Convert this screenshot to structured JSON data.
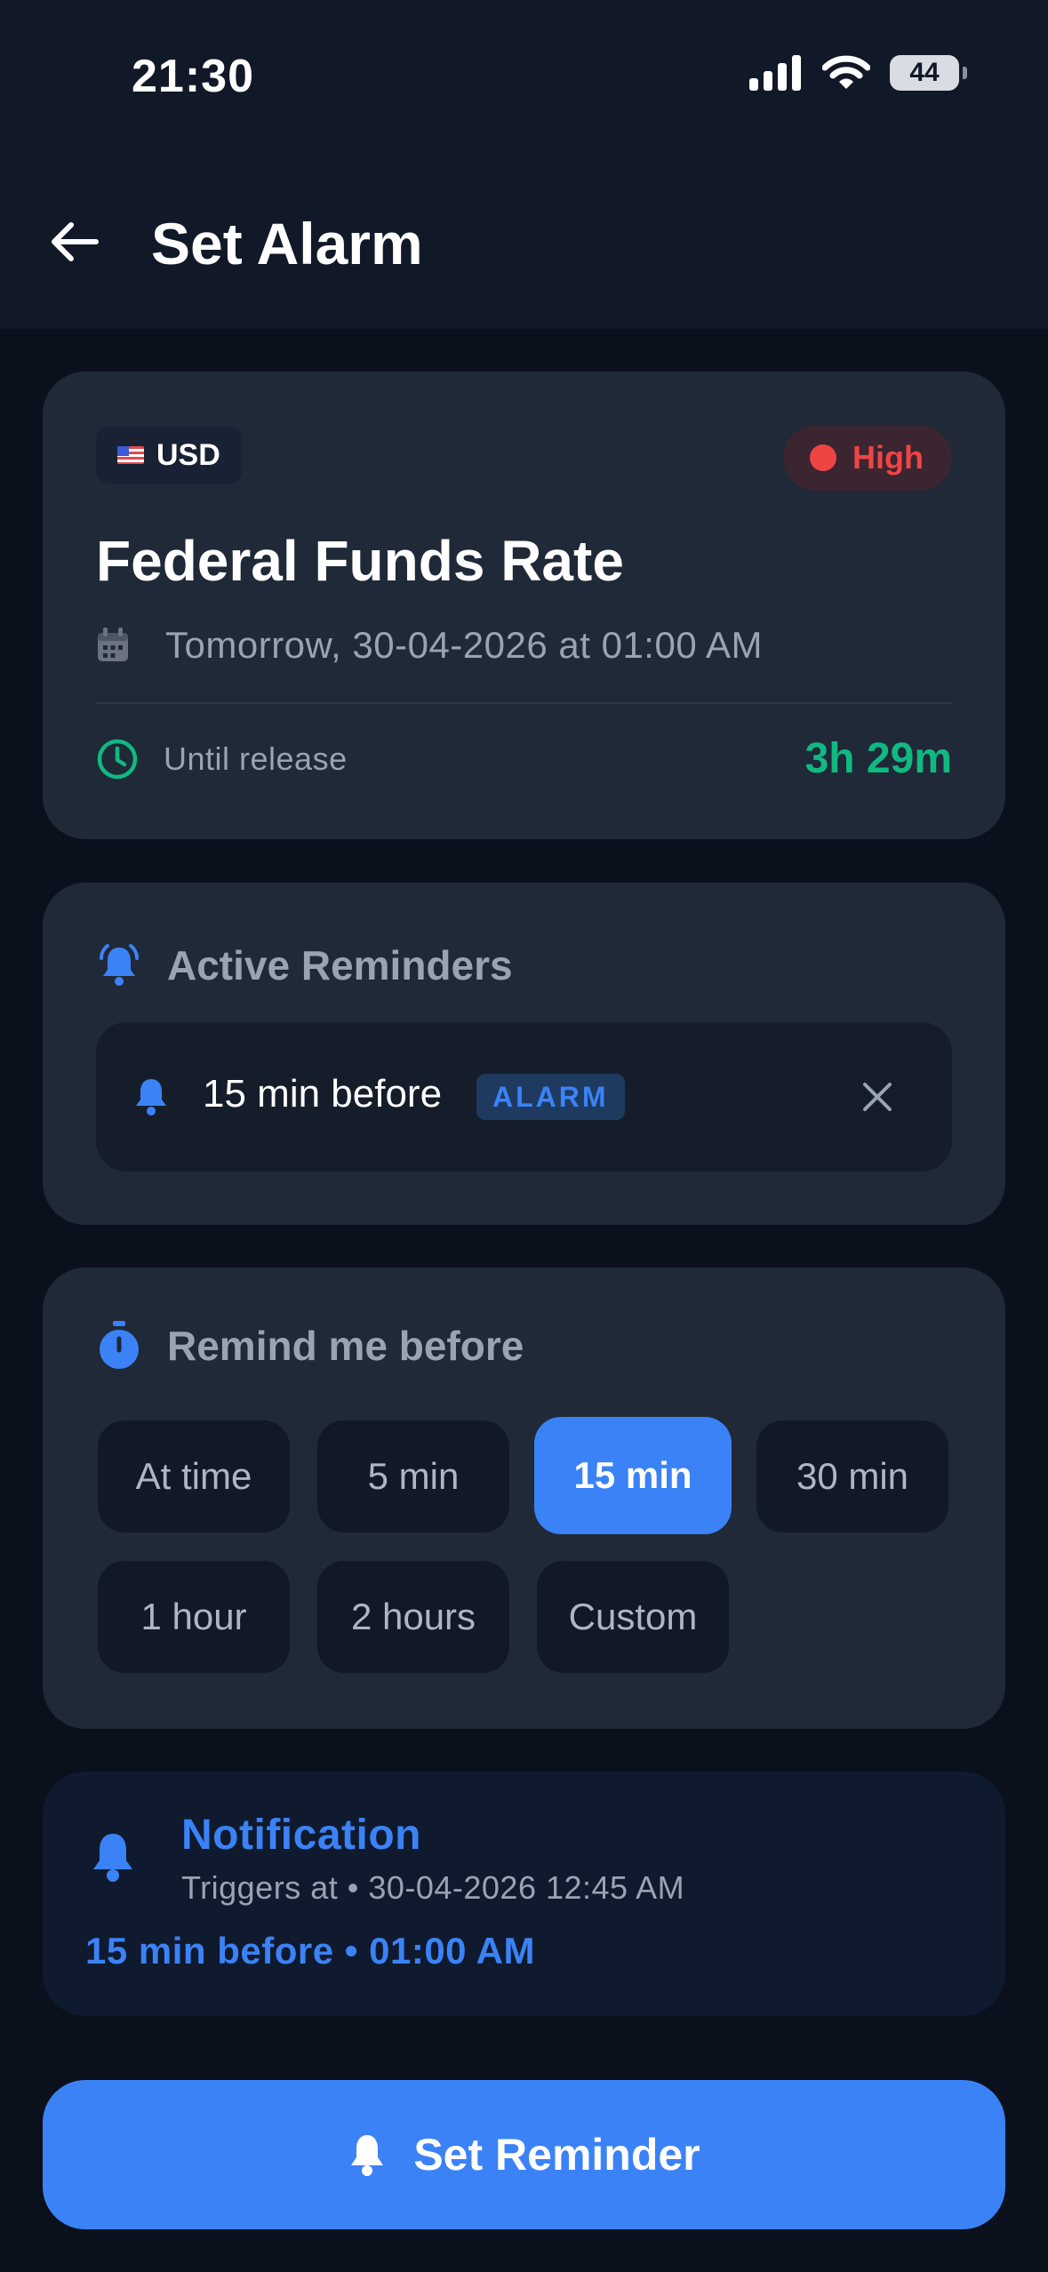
{
  "status_bar": {
    "time": "21:30",
    "battery": "44"
  },
  "header": {
    "title": "Set Alarm"
  },
  "event": {
    "currency": "USD",
    "impact": "High",
    "title": "Federal Funds Rate",
    "datetime": "Tomorrow, 30-04-2026 at 01:00 AM",
    "until_label": "Until release",
    "countdown": "3h 29m"
  },
  "active_reminders": {
    "title": "Active Reminders",
    "items": [
      {
        "label": "15 min before",
        "tag": "ALARM"
      }
    ]
  },
  "remind_before": {
    "title": "Remind me before",
    "options": [
      "At time",
      "5 min",
      "15 min",
      "30 min",
      "1 hour",
      "2 hours",
      "Custom"
    ],
    "selected": "15 min"
  },
  "notification": {
    "title": "Notification",
    "subtitle": "Triggers at • 30-04-2026 12:45 AM",
    "summary": "15 min before • 01:00 AM"
  },
  "action": {
    "label": "Set Reminder"
  },
  "colors": {
    "accent": "#3b82f6",
    "danger": "#ef4444",
    "success": "#10b981",
    "card": "#1f2937",
    "background": "#0b111c"
  }
}
